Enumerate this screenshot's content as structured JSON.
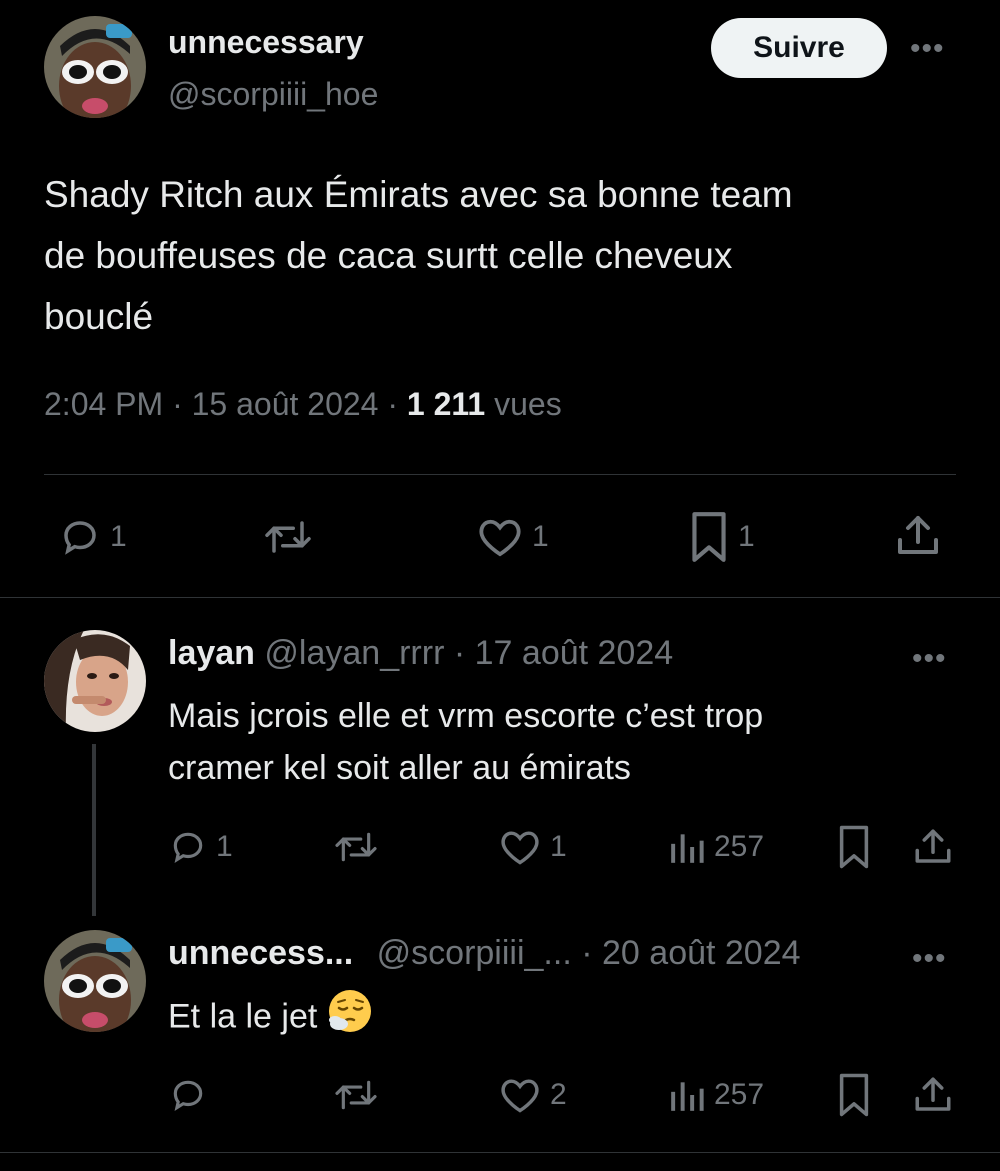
{
  "main_tweet": {
    "display_name": "unnecessary",
    "handle": "@scorpiiii_hoe",
    "follow_label": "Suivre",
    "more_label": "•••",
    "text_lines": [
      "Shady Ritch aux Émirats avec sa bonne team",
      "de bouffeuses de caca surtt celle cheveux",
      "bouclé"
    ],
    "time": "2:04 PM",
    "sep": "·",
    "date": "15 août 2024",
    "views_count": "1 211",
    "views_label": "vues",
    "actions": {
      "reply_icon": "reply-icon",
      "reply_count": "1",
      "retweet_icon": "retweet-icon",
      "retweet_count": "",
      "like_icon": "heart-icon",
      "like_count": "1",
      "bookmark_icon": "bookmark-icon",
      "bookmark_count": "1",
      "share_icon": "share-icon"
    }
  },
  "replies": [
    {
      "display_name": "layan",
      "handle": "@layan_rrrr",
      "sep": "·",
      "date": "17 août 2024",
      "more_label": "•••",
      "text_lines": [
        "Mais jcrois elle et vrm escorte c’est trop",
        "cramer kel soit aller au émirats"
      ],
      "reply_count": "1",
      "retweet_count": "",
      "like_count": "1",
      "views_count": "257"
    },
    {
      "display_name": "unnecess...",
      "handle": "@scorpiiii_...",
      "sep": "·",
      "date": "20 août 2024",
      "more_label": "•••",
      "text": "Et la le jet",
      "emoji_name": "smoking-face-emoji",
      "reply_count": "",
      "retweet_count": "",
      "like_count": "2",
      "views_count": "257"
    }
  ],
  "colors": {
    "background": "#000000",
    "text": "#e7e9ea",
    "muted": "#71767b",
    "divider": "#2f3336",
    "follow_bg": "#eff3f4"
  }
}
